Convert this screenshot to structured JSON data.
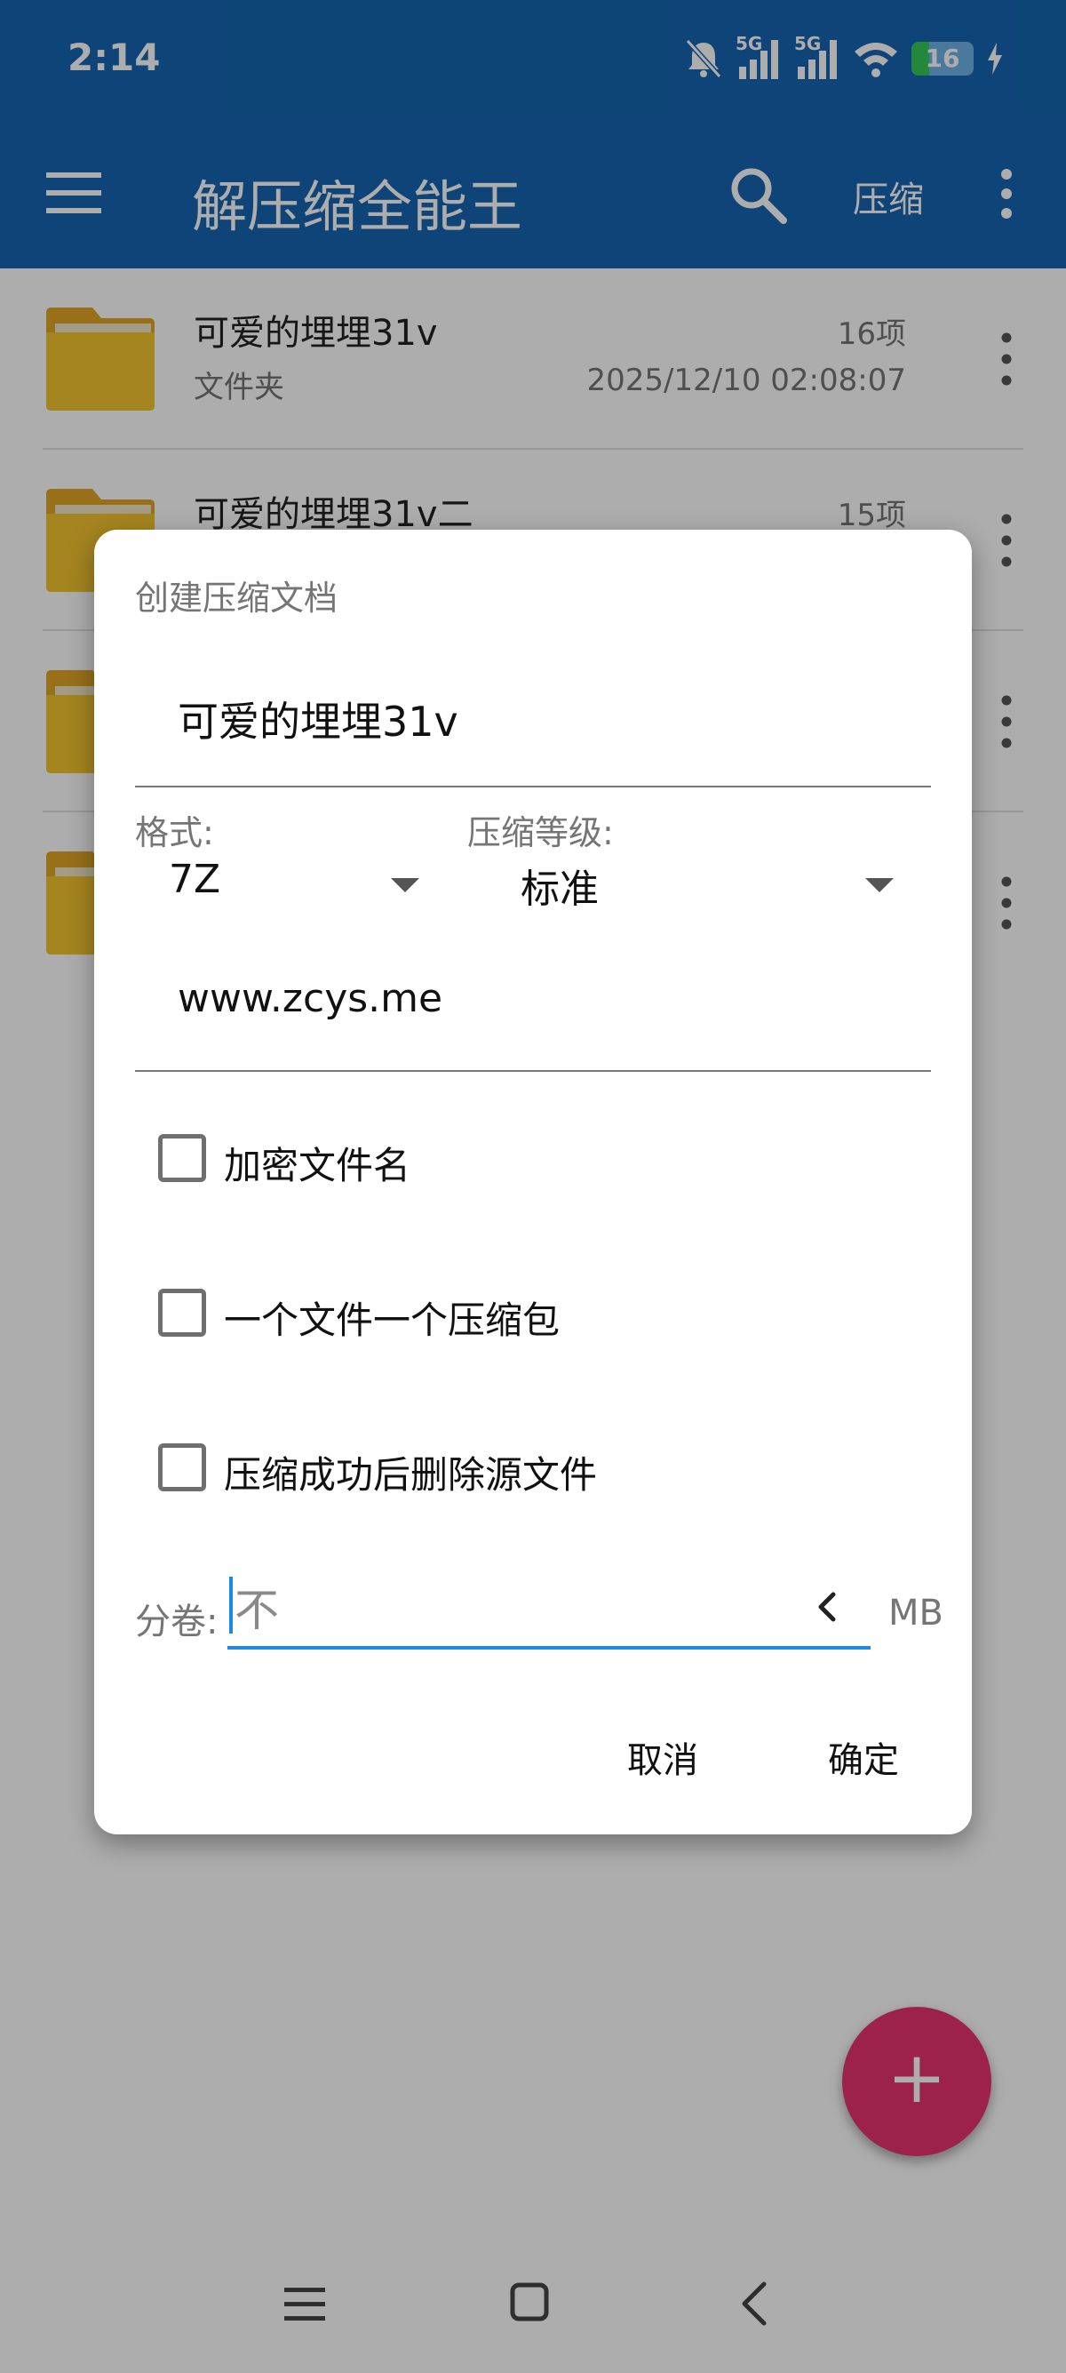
{
  "status_bar": {
    "time": "2:14",
    "net1": "5G",
    "net2": "5G",
    "battery": "16"
  },
  "app_bar": {
    "title": "解压缩全能王",
    "compress_label": "压缩"
  },
  "files": [
    {
      "name": "可爱的埋埋31v",
      "type": "文件夹",
      "count": "16项",
      "date": "2025/12/10 02:08:07"
    },
    {
      "name": "可爱的埋埋31v二",
      "type": "",
      "count": "15项",
      "date": ""
    },
    {
      "name": "",
      "type": "",
      "count": "",
      "date": ""
    },
    {
      "name": "",
      "type": "",
      "count": "",
      "date": ""
    }
  ],
  "dialog": {
    "title": "创建压缩文档",
    "archive_name": "可爱的埋埋31v",
    "format_label": "格式:",
    "format_value": "7Z",
    "level_label": "压缩等级:",
    "level_value": "标准",
    "comment": "www.zcys.me",
    "options": [
      {
        "label": "加密文件名",
        "checked": false
      },
      {
        "label": "一个文件一个压缩包",
        "checked": false
      },
      {
        "label": "压缩成功后删除源文件",
        "checked": false
      }
    ],
    "split_label": "分卷:",
    "split_value": "不",
    "split_unit": "MB",
    "cancel": "取消",
    "ok": "确定"
  },
  "colors": {
    "primary": "#1565b0",
    "accent": "#e8336f",
    "folder": "#f4c430",
    "focus": "#1e88e5"
  }
}
